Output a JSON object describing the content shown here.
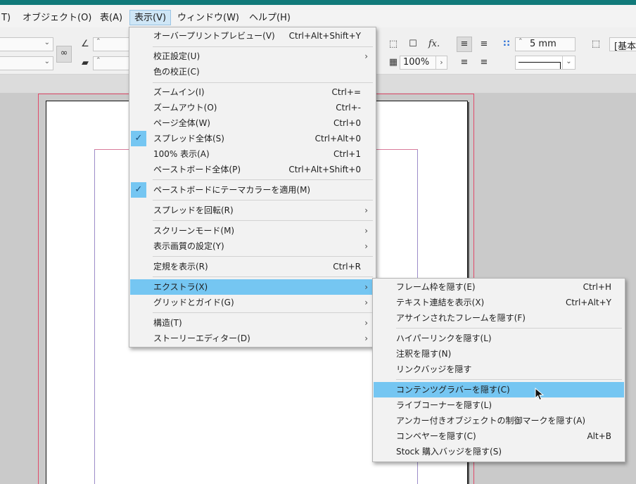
{
  "menubar": {
    "items": [
      {
        "label": "T)"
      },
      {
        "label": "オブジェクト(O)"
      },
      {
        "label": "表(A)"
      },
      {
        "label": "表示(V)"
      },
      {
        "label": "ウィンドウ(W)"
      },
      {
        "label": "ヘルプ(H)"
      }
    ]
  },
  "control": {
    "stroke_weight": "5 mm",
    "zoom_percent": "100%",
    "style_label": "[基本",
    "fx_label": "fx."
  },
  "view_menu": {
    "items": [
      {
        "label": "オーバープリントプレビュー(V)",
        "shortcut": "Ctrl+Alt+Shift+Y"
      },
      {
        "label": "校正設定(U)"
      },
      {
        "label": "色の校正(C)"
      },
      {
        "label": "ズームイン(I)",
        "shortcut": "Ctrl+="
      },
      {
        "label": "ズームアウト(O)",
        "shortcut": "Ctrl+-"
      },
      {
        "label": "ページ全体(W)",
        "shortcut": "Ctrl+0"
      },
      {
        "label": "スプレッド全体(S)",
        "shortcut": "Ctrl+Alt+0",
        "checked": true
      },
      {
        "label": "100% 表示(A)",
        "shortcut": "Ctrl+1"
      },
      {
        "label": "ペーストボード全体(P)",
        "shortcut": "Ctrl+Alt+Shift+0"
      },
      {
        "label": "ペーストボードにテーマカラーを適用(M)",
        "checked": true
      },
      {
        "label": "スプレッドを回転(R)"
      },
      {
        "label": "スクリーンモード(M)"
      },
      {
        "label": "表示画質の設定(Y)"
      },
      {
        "label": "定規を表示(R)",
        "shortcut": "Ctrl+R"
      },
      {
        "label": "エクストラ(X)",
        "highlighted": true
      },
      {
        "label": "グリッドとガイド(G)"
      },
      {
        "label": "構造(T)"
      },
      {
        "label": "ストーリーエディター(D)"
      }
    ]
  },
  "extras_menu": {
    "items": [
      {
        "label": "フレーム枠を隠す(E)",
        "shortcut": "Ctrl+H"
      },
      {
        "label": "テキスト連結を表示(X)",
        "shortcut": "Ctrl+Alt+Y"
      },
      {
        "label": "アサインされたフレームを隠す(F)"
      },
      {
        "label": "ハイパーリンクを隠す(L)"
      },
      {
        "label": "注釈を隠す(N)"
      },
      {
        "label": "リンクバッジを隠す"
      },
      {
        "label": "コンテンツグラバーを隠す(C)",
        "highlighted": true
      },
      {
        "label": "ライブコーナーを隠す(L)"
      },
      {
        "label": "アンカー付きオブジェクトの制御マークを隠す(A)"
      },
      {
        "label": "コンベヤーを隠す(C)",
        "shortcut": "Alt+B"
      },
      {
        "label": "Stock 購入バッジを隠す(S)"
      }
    ]
  },
  "colors": {
    "accent_bar": "#117a7a",
    "highlight": "#75c6f2",
    "bleed_guide": "#e14a6a",
    "margin_guide": "#9c8cc8"
  }
}
